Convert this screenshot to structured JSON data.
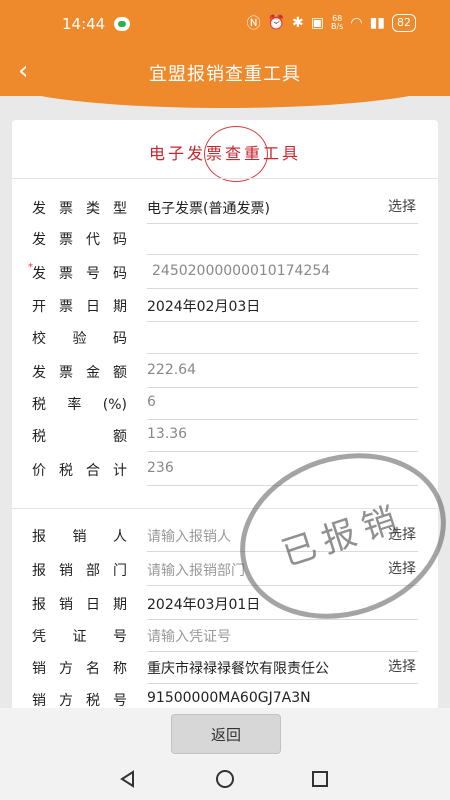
{
  "status_bar": {
    "time": "14:44",
    "net_speed": "68\nB/s",
    "battery": "82"
  },
  "header": {
    "title": "宜盟报销查重工具"
  },
  "card": {
    "title": "电子发票查重工具"
  },
  "invoice_fields": [
    {
      "label": "发票类型",
      "value": "电子发票(普通发票)",
      "action": "选择"
    },
    {
      "label": "发票代码",
      "value": ""
    },
    {
      "label": "发票号码",
      "value": "24502000000010174254",
      "required": "*"
    },
    {
      "label": "开票日期",
      "value": "2024年02月03日"
    },
    {
      "label": "校验码",
      "value": ""
    },
    {
      "label": "发票金额",
      "value": "222.64"
    },
    {
      "label": "税率(%)",
      "value": "6"
    },
    {
      "label": "税额",
      "value": "13.36"
    },
    {
      "label": "价税合计",
      "value": "236"
    }
  ],
  "reimburse_fields": [
    {
      "label": "报销人",
      "placeholder": "请输入报销人",
      "action": "选择"
    },
    {
      "label": "报销部门",
      "placeholder": "请输入报销部门",
      "action": "选择"
    },
    {
      "label": "报销日期",
      "value": "2024年03月01日"
    },
    {
      "label": "凭证号",
      "placeholder": "请输入凭证号"
    },
    {
      "label": "销方名称",
      "value": "重庆市禄禄禄餐饮有限责任公",
      "action": "选择"
    },
    {
      "label": "销方税号",
      "value": "91500000MA60GJ7A3N"
    }
  ],
  "stamp": {
    "text": "已报销"
  },
  "footer": {
    "return_label": "返回"
  }
}
